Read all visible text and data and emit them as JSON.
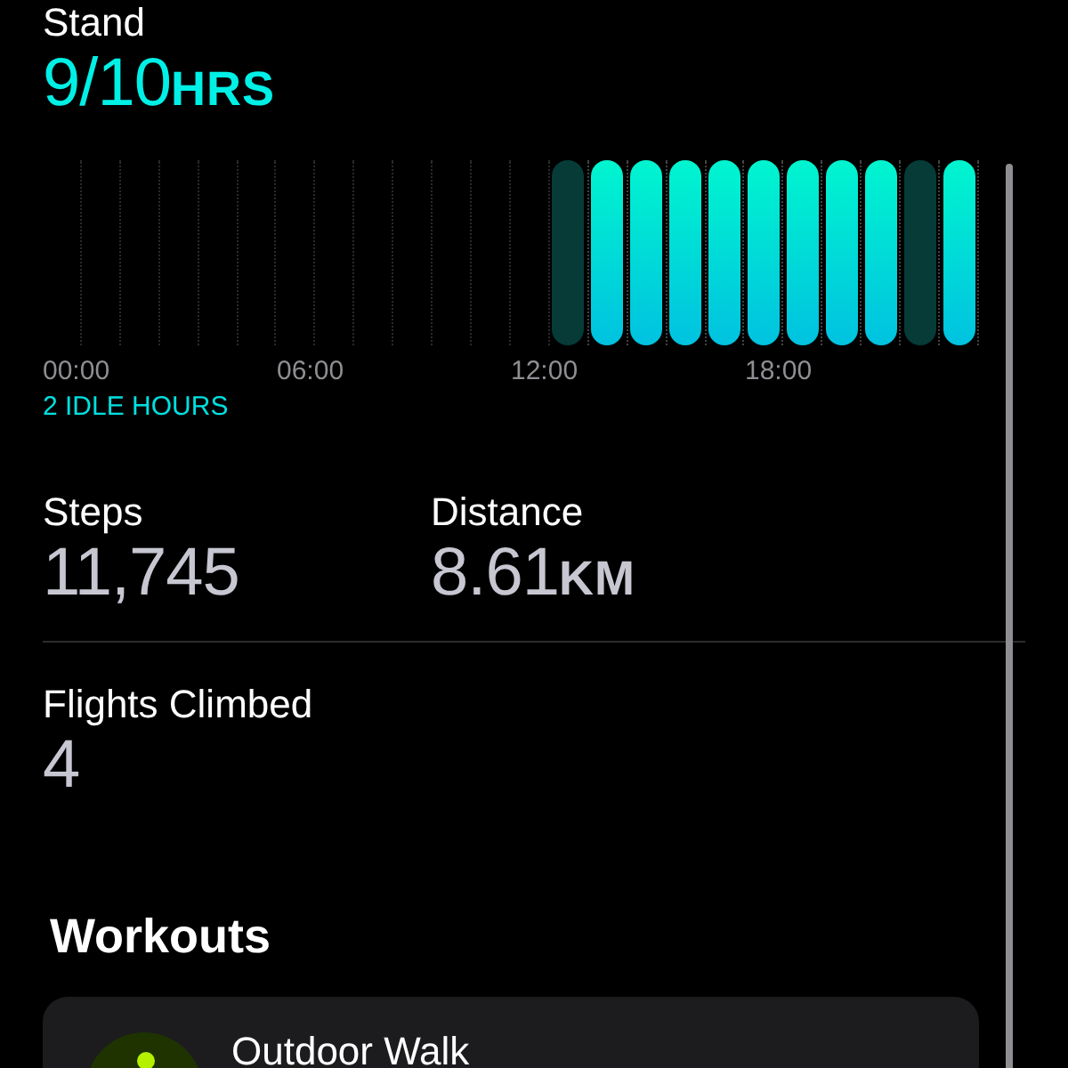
{
  "stand": {
    "label": "Stand",
    "value": "9/10",
    "unit": "HRS",
    "hours": [
      {
        "active": false
      },
      {
        "active": false
      },
      {
        "active": false
      },
      {
        "active": false
      },
      {
        "active": false
      },
      {
        "active": false
      },
      {
        "active": false
      },
      {
        "active": false
      },
      {
        "active": false
      },
      {
        "active": false
      },
      {
        "active": false
      },
      {
        "active": false
      },
      {
        "active": false
      },
      {
        "active": true,
        "stood": false
      },
      {
        "active": true,
        "stood": true
      },
      {
        "active": true,
        "stood": true
      },
      {
        "active": true,
        "stood": true
      },
      {
        "active": true,
        "stood": true
      },
      {
        "active": true,
        "stood": true
      },
      {
        "active": true,
        "stood": true
      },
      {
        "active": true,
        "stood": true
      },
      {
        "active": true,
        "stood": true
      },
      {
        "active": true,
        "stood": false
      },
      {
        "active": true,
        "stood": true
      }
    ],
    "ticks": [
      "00:00",
      "06:00",
      "12:00",
      "18:00"
    ],
    "idle_note": "2 IDLE HOURS"
  },
  "metrics": [
    {
      "label": "Steps",
      "value": "11,745"
    },
    {
      "label": "Distance",
      "value": "8.61",
      "unit": "KM"
    }
  ],
  "flights": {
    "label": "Flights Climbed",
    "value": "4"
  },
  "workouts": {
    "title": "Workouts",
    "items": [
      {
        "name": "Outdoor Walk"
      }
    ]
  }
}
